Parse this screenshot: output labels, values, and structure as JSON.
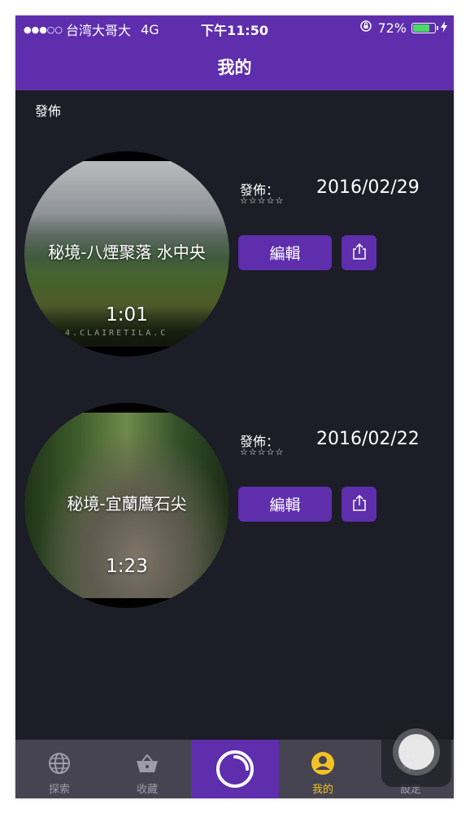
{
  "status_bar": {
    "signal_dots": "●●●○○",
    "carrier": "台湾大哥大",
    "network": "4G",
    "time": "下午11:50",
    "battery_percent": "72%",
    "battery_level": 0.72
  },
  "header": {
    "title": "我的"
  },
  "section": {
    "label": "發佈"
  },
  "posts": [
    {
      "title": "秘境-八煙聚落 水中央",
      "duration": "1:01",
      "watermark": "4.CLAIRETILA.C",
      "publish_label": "發佈：",
      "rating_stars": "☆☆☆☆☆",
      "date": "2016/02/29",
      "edit_label": "編輯"
    },
    {
      "title": "秘境-宜蘭鷹石尖",
      "duration": "1:23",
      "watermark": "",
      "publish_label": "發佈：",
      "rating_stars": "☆☆☆☆☆",
      "date": "2016/02/22",
      "edit_label": "編輯"
    }
  ],
  "tabs": [
    {
      "label": "探索",
      "icon": "globe-icon"
    },
    {
      "label": "收藏",
      "icon": "basket-icon"
    },
    {
      "label": "",
      "icon": "record-icon"
    },
    {
      "label": "我的",
      "icon": "user-icon"
    },
    {
      "label": "設定",
      "icon": "gear-icon"
    }
  ],
  "colors": {
    "brand_purple": "#5e2ead",
    "background": "#1c1d27",
    "tab_bar": "#464451",
    "active_tab": "#f2c327"
  }
}
